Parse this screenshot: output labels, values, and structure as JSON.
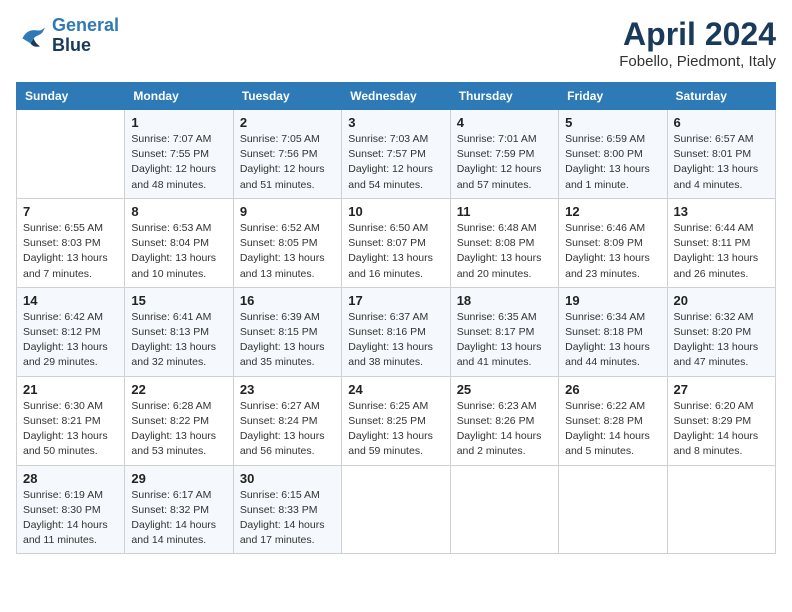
{
  "logo": {
    "line1": "General",
    "line2": "Blue"
  },
  "title": "April 2024",
  "subtitle": "Fobello, Piedmont, Italy",
  "headers": [
    "Sunday",
    "Monday",
    "Tuesday",
    "Wednesday",
    "Thursday",
    "Friday",
    "Saturday"
  ],
  "weeks": [
    [
      {
        "day": "",
        "info": ""
      },
      {
        "day": "1",
        "info": "Sunrise: 7:07 AM\nSunset: 7:55 PM\nDaylight: 12 hours\nand 48 minutes."
      },
      {
        "day": "2",
        "info": "Sunrise: 7:05 AM\nSunset: 7:56 PM\nDaylight: 12 hours\nand 51 minutes."
      },
      {
        "day": "3",
        "info": "Sunrise: 7:03 AM\nSunset: 7:57 PM\nDaylight: 12 hours\nand 54 minutes."
      },
      {
        "day": "4",
        "info": "Sunrise: 7:01 AM\nSunset: 7:59 PM\nDaylight: 12 hours\nand 57 minutes."
      },
      {
        "day": "5",
        "info": "Sunrise: 6:59 AM\nSunset: 8:00 PM\nDaylight: 13 hours\nand 1 minute."
      },
      {
        "day": "6",
        "info": "Sunrise: 6:57 AM\nSunset: 8:01 PM\nDaylight: 13 hours\nand 4 minutes."
      }
    ],
    [
      {
        "day": "7",
        "info": "Sunrise: 6:55 AM\nSunset: 8:03 PM\nDaylight: 13 hours\nand 7 minutes."
      },
      {
        "day": "8",
        "info": "Sunrise: 6:53 AM\nSunset: 8:04 PM\nDaylight: 13 hours\nand 10 minutes."
      },
      {
        "day": "9",
        "info": "Sunrise: 6:52 AM\nSunset: 8:05 PM\nDaylight: 13 hours\nand 13 minutes."
      },
      {
        "day": "10",
        "info": "Sunrise: 6:50 AM\nSunset: 8:07 PM\nDaylight: 13 hours\nand 16 minutes."
      },
      {
        "day": "11",
        "info": "Sunrise: 6:48 AM\nSunset: 8:08 PM\nDaylight: 13 hours\nand 20 minutes."
      },
      {
        "day": "12",
        "info": "Sunrise: 6:46 AM\nSunset: 8:09 PM\nDaylight: 13 hours\nand 23 minutes."
      },
      {
        "day": "13",
        "info": "Sunrise: 6:44 AM\nSunset: 8:11 PM\nDaylight: 13 hours\nand 26 minutes."
      }
    ],
    [
      {
        "day": "14",
        "info": "Sunrise: 6:42 AM\nSunset: 8:12 PM\nDaylight: 13 hours\nand 29 minutes."
      },
      {
        "day": "15",
        "info": "Sunrise: 6:41 AM\nSunset: 8:13 PM\nDaylight: 13 hours\nand 32 minutes."
      },
      {
        "day": "16",
        "info": "Sunrise: 6:39 AM\nSunset: 8:15 PM\nDaylight: 13 hours\nand 35 minutes."
      },
      {
        "day": "17",
        "info": "Sunrise: 6:37 AM\nSunset: 8:16 PM\nDaylight: 13 hours\nand 38 minutes."
      },
      {
        "day": "18",
        "info": "Sunrise: 6:35 AM\nSunset: 8:17 PM\nDaylight: 13 hours\nand 41 minutes."
      },
      {
        "day": "19",
        "info": "Sunrise: 6:34 AM\nSunset: 8:18 PM\nDaylight: 13 hours\nand 44 minutes."
      },
      {
        "day": "20",
        "info": "Sunrise: 6:32 AM\nSunset: 8:20 PM\nDaylight: 13 hours\nand 47 minutes."
      }
    ],
    [
      {
        "day": "21",
        "info": "Sunrise: 6:30 AM\nSunset: 8:21 PM\nDaylight: 13 hours\nand 50 minutes."
      },
      {
        "day": "22",
        "info": "Sunrise: 6:28 AM\nSunset: 8:22 PM\nDaylight: 13 hours\nand 53 minutes."
      },
      {
        "day": "23",
        "info": "Sunrise: 6:27 AM\nSunset: 8:24 PM\nDaylight: 13 hours\nand 56 minutes."
      },
      {
        "day": "24",
        "info": "Sunrise: 6:25 AM\nSunset: 8:25 PM\nDaylight: 13 hours\nand 59 minutes."
      },
      {
        "day": "25",
        "info": "Sunrise: 6:23 AM\nSunset: 8:26 PM\nDaylight: 14 hours\nand 2 minutes."
      },
      {
        "day": "26",
        "info": "Sunrise: 6:22 AM\nSunset: 8:28 PM\nDaylight: 14 hours\nand 5 minutes."
      },
      {
        "day": "27",
        "info": "Sunrise: 6:20 AM\nSunset: 8:29 PM\nDaylight: 14 hours\nand 8 minutes."
      }
    ],
    [
      {
        "day": "28",
        "info": "Sunrise: 6:19 AM\nSunset: 8:30 PM\nDaylight: 14 hours\nand 11 minutes."
      },
      {
        "day": "29",
        "info": "Sunrise: 6:17 AM\nSunset: 8:32 PM\nDaylight: 14 hours\nand 14 minutes."
      },
      {
        "day": "30",
        "info": "Sunrise: 6:15 AM\nSunset: 8:33 PM\nDaylight: 14 hours\nand 17 minutes."
      },
      {
        "day": "",
        "info": ""
      },
      {
        "day": "",
        "info": ""
      },
      {
        "day": "",
        "info": ""
      },
      {
        "day": "",
        "info": ""
      }
    ]
  ]
}
